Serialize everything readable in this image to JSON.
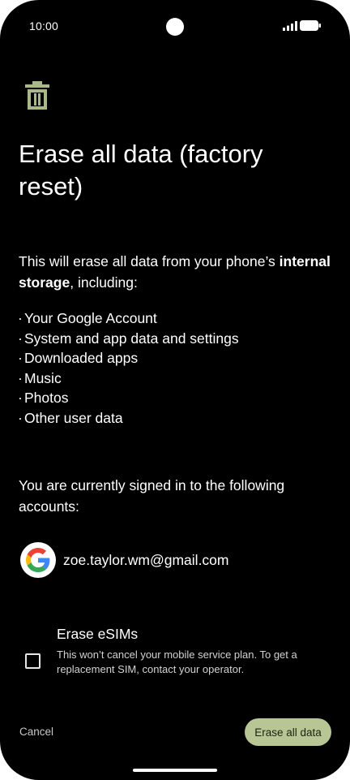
{
  "status_bar": {
    "time": "10:00"
  },
  "dialog": {
    "title": "Erase all data (factory reset)",
    "intro_prefix": "This will erase all data from your phone’s ",
    "intro_bold": "internal storage",
    "intro_suffix": ", including:",
    "items": [
      "Your Google Account",
      "System and app data and settings",
      "Downloaded apps",
      "Music",
      "Photos",
      "Other user data"
    ],
    "signed_in_text": "You are currently signed in to the following accounts:",
    "account_email": "zoe.taylor.wm@gmail.com",
    "esim_title": "Erase eSIMs",
    "esim_description": "This won’t cancel your mobile service plan. To get a replacement SIM, contact your operator.",
    "esim_checked": false,
    "cancel_label": "Cancel",
    "erase_label": "Erase all data"
  },
  "colors": {
    "background": "#000000",
    "accent": "#b7c694",
    "icon": "#a9b889"
  },
  "icons": {
    "header": "trash-icon",
    "account": "google-logo-icon"
  }
}
